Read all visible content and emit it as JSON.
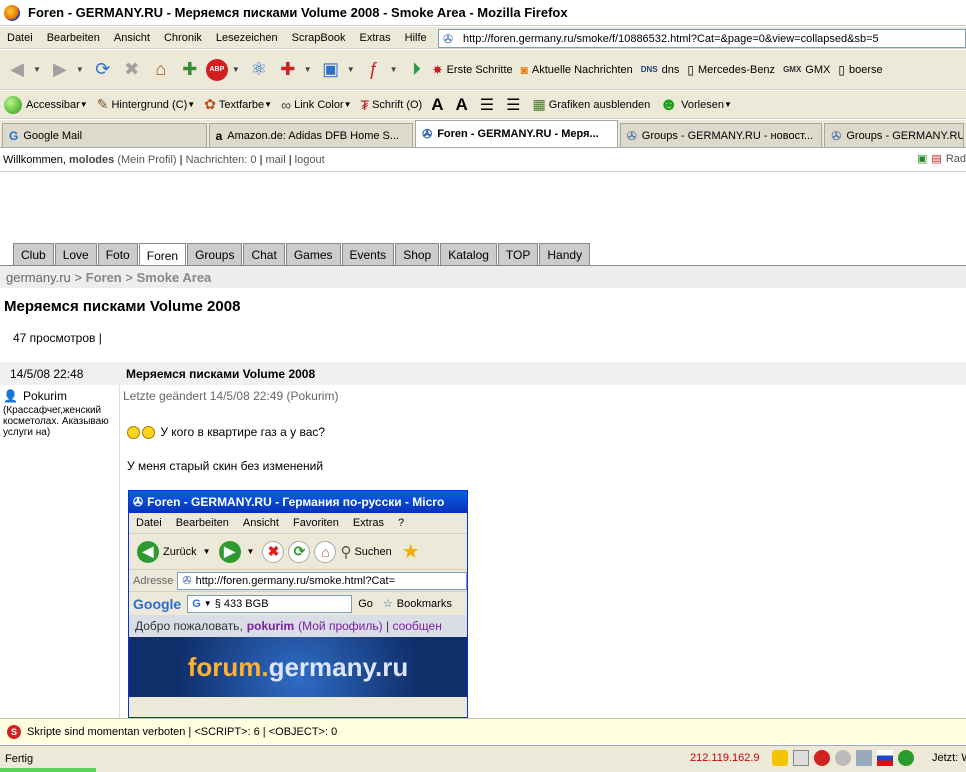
{
  "window": {
    "title": "Foren - GERMANY.RU - Меряемся писками Volume 2008 - Smoke Area - Mozilla Firefox"
  },
  "menu": [
    "Datei",
    "Bearbeiten",
    "Ansicht",
    "Chronik",
    "Lesezeichen",
    "ScrapBook",
    "Extras",
    "Hilfe"
  ],
  "address": {
    "url": "http://foren.germany.ru/smoke/f/10886532.html?Cat=&page=0&view=collapsed&sb=5"
  },
  "bookmarks": [
    {
      "icon": "red-star-icon",
      "label": "Erste Schritte"
    },
    {
      "icon": "rss-icon",
      "label": "Aktuelle Nachrichten"
    },
    {
      "icon": "dns-icon",
      "label": "dns"
    },
    {
      "icon": "page-icon",
      "label": "Mercedes-Benz"
    },
    {
      "icon": "gmx-icon",
      "label": "GMX"
    },
    {
      "icon": "page-icon",
      "label": "boerse"
    }
  ],
  "accessibar": {
    "items": [
      "Accessibar",
      "Hintergrund (C)",
      "Textfarbe",
      "Link Color",
      "Schrift (O)",
      "Grafiken ausblenden",
      "Vorlesen"
    ]
  },
  "tabs": [
    {
      "label": "Google Mail",
      "active": false
    },
    {
      "label": "Amazon.de: Adidas DFB Home S...",
      "active": false
    },
    {
      "label": "Foren - GERMANY.RU - Меря...",
      "active": true
    },
    {
      "label": "Groups - GERMANY.RU - новост...",
      "active": false
    },
    {
      "label": "Groups - GERMANY.RU",
      "active": false
    }
  ],
  "userbar": {
    "welcome": "Willkommen,",
    "username": "molodes",
    "profile": "(Mein Profil)",
    "messages": "Nachrichten: 0",
    "mail": "mail",
    "logout": "logout",
    "right_label": "Rad"
  },
  "site_tabs": [
    "Club",
    "Love",
    "Foto",
    "Foren",
    "Groups",
    "Chat",
    "Games",
    "Events",
    "Shop",
    "Katalog",
    "TOP",
    "Handy"
  ],
  "site_tabs_active": "Foren",
  "breadcrumb": {
    "root": "germany.ru",
    "sep": ">",
    "level1": "Foren",
    "level2": "Smoke Area"
  },
  "thread": {
    "title": "Меряемся писками Volume 2008",
    "views": "47 просмотров |"
  },
  "post": {
    "date": "14/5/08 22:48",
    "title": "Меряемся писками Volume 2008",
    "author": "Pokurim",
    "author_status": "(Крассафчег,женский косметолах. Аказываю услуги на)",
    "last_edited": "Letzte geändert 14/5/08 22:49 (Pokurim)",
    "text1": "У кого в квартире газ а у вас?",
    "text2": "У меня старый скин без изменений"
  },
  "embedded_screenshot": {
    "title": "Foren - GERMANY.RU - Германия по-русски - Micro",
    "menu": [
      "Datei",
      "Bearbeiten",
      "Ansicht",
      "Favoriten",
      "Extras",
      "?"
    ],
    "back": "Zurück",
    "search": "Suchen",
    "address_label": "Adresse",
    "address_url": "http://foren.germany.ru/smoke.html?Cat=",
    "google_label": "Google",
    "google_query": "§ 433 BGB",
    "go": "Go",
    "bookmarks": "Bookmarks",
    "welcome": "Добро пожаловать,",
    "username": "pokurim",
    "profile": "(Мой профиль)",
    "messages": "сообщен",
    "banner_a": "forum.",
    "banner_b": "germany.ru"
  },
  "notification": {
    "text": "Skripte sind momentan verboten | <SCRIPT>: 6 | <OBJECT>: 0"
  },
  "status": {
    "text": "Fertig",
    "ip": "212.119.162.9",
    "now": "Jetzt: W"
  }
}
